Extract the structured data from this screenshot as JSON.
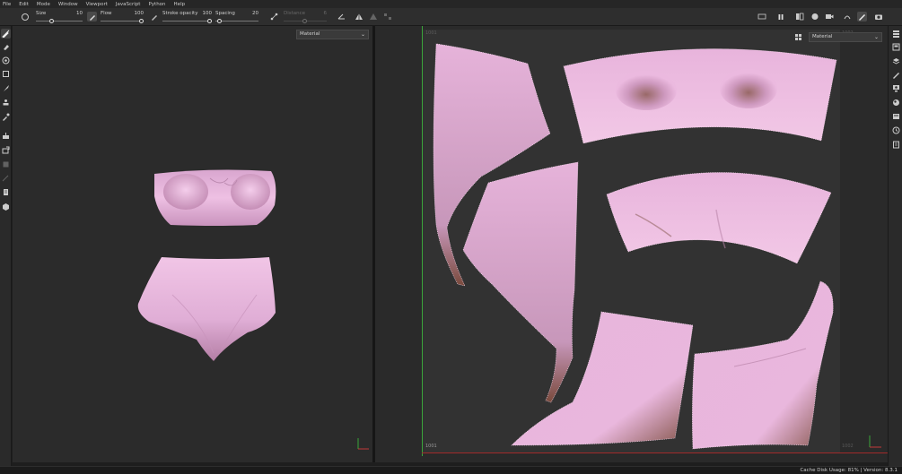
{
  "menu": {
    "items": [
      {
        "label": "File"
      },
      {
        "label": "Edit"
      },
      {
        "label": "Mode"
      },
      {
        "label": "Window"
      },
      {
        "label": "Viewport"
      },
      {
        "label": "JavaScript"
      },
      {
        "label": "Python"
      },
      {
        "label": "Help"
      }
    ]
  },
  "toolbar": {
    "size": {
      "label": "Size",
      "value": "10",
      "level": 0.4
    },
    "flow": {
      "label": "Flow",
      "value": "100",
      "level": 1.0
    },
    "stroke_opacity": {
      "label": "Stroke opacity",
      "value": "100",
      "level": 1.0
    },
    "spacing": {
      "label": "Spacing",
      "value": "20",
      "level": 0.05
    },
    "distance": {
      "label": "Distance",
      "value": "6",
      "level": 0.5
    }
  },
  "viewport3d": {
    "material_select": {
      "value": "Material"
    }
  },
  "viewport2d": {
    "material_select": {
      "value": "Material"
    },
    "tile_label_bottom": "1001",
    "tile_label_top": "1001",
    "tile_label_right": "1002",
    "tile_label_right_bottom": "1002"
  },
  "statusbar": {
    "text": "Cache Disk Usage:  81% | Version: 8.3.1"
  },
  "colors": {
    "fabric": "#e7b4dc",
    "fabric_shadow": "#a56b8b",
    "fabric_dark": "#6e4338",
    "uv_axis_green": "#3aa53a",
    "uv_axis_red": "#a12a2a"
  },
  "icons": {
    "left": [
      "paint-brush-icon",
      "eraser-icon",
      "projection-icon",
      "polygon-fill-icon",
      "smudge-icon",
      "clone-stamp-icon",
      "color-picker-icon",
      "bake-icon",
      "export-icon",
      "iray-icon",
      "document-icon",
      "box-icon"
    ],
    "right": [
      "texture-set-list-icon",
      "texture-set-settings-icon",
      "layers-icon",
      "properties-icon",
      "display-settings-icon",
      "shader-settings-icon",
      "shelf-icon",
      "history-icon",
      "log-icon"
    ]
  }
}
